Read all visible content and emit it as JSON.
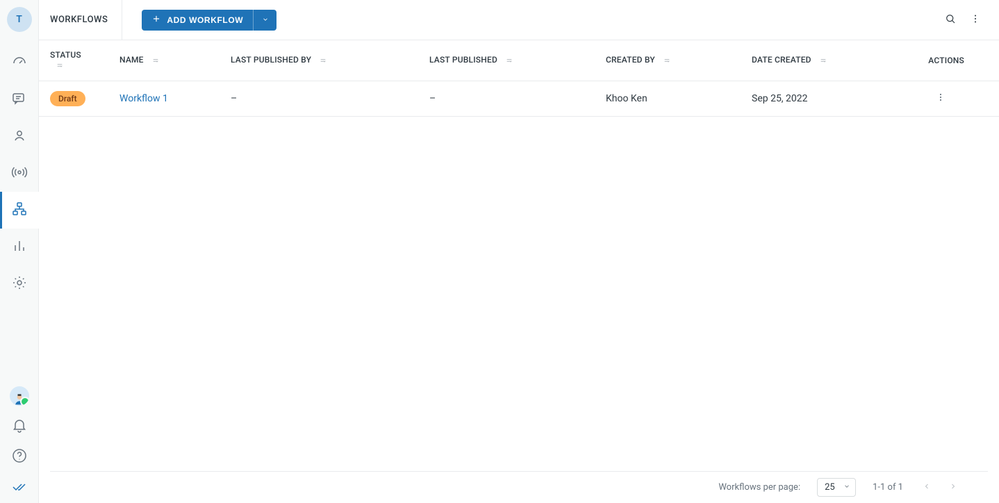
{
  "avatar_initial": "T",
  "header": {
    "page_title": "WORKFLOWS",
    "add_button_label": "ADD WORKFLOW"
  },
  "columns": {
    "status": "STATUS",
    "name": "NAME",
    "last_published_by": "LAST PUBLISHED BY",
    "last_published": "LAST PUBLISHED",
    "created_by": "CREATED BY",
    "date_created": "DATE CREATED",
    "actions": "ACTIONS"
  },
  "rows": [
    {
      "status_label": "Draft",
      "status_kind": "draft",
      "name": "Workflow 1",
      "last_published_by": "–",
      "last_published": "–",
      "created_by": "Khoo Ken",
      "date_created": "Sep 25, 2022"
    }
  ],
  "pagination": {
    "per_page_label": "Workflows per page:",
    "per_page_value": "25",
    "range_text": "1-1 of 1"
  },
  "sidebar": {
    "items": [
      {
        "name": "dashboard-icon"
      },
      {
        "name": "comments-icon"
      },
      {
        "name": "person-icon"
      },
      {
        "name": "broadcast-icon"
      },
      {
        "name": "workflows-icon",
        "active": true
      },
      {
        "name": "analytics-icon"
      },
      {
        "name": "settings-icon"
      }
    ],
    "bottom": [
      {
        "name": "user-avatar-icon"
      },
      {
        "name": "notifications-icon"
      },
      {
        "name": "help-icon"
      },
      {
        "name": "read-all-icon"
      }
    ]
  },
  "colors": {
    "primary": "#1f73b7",
    "draft_bg": "#ffb057",
    "draft_fg": "#703815"
  }
}
